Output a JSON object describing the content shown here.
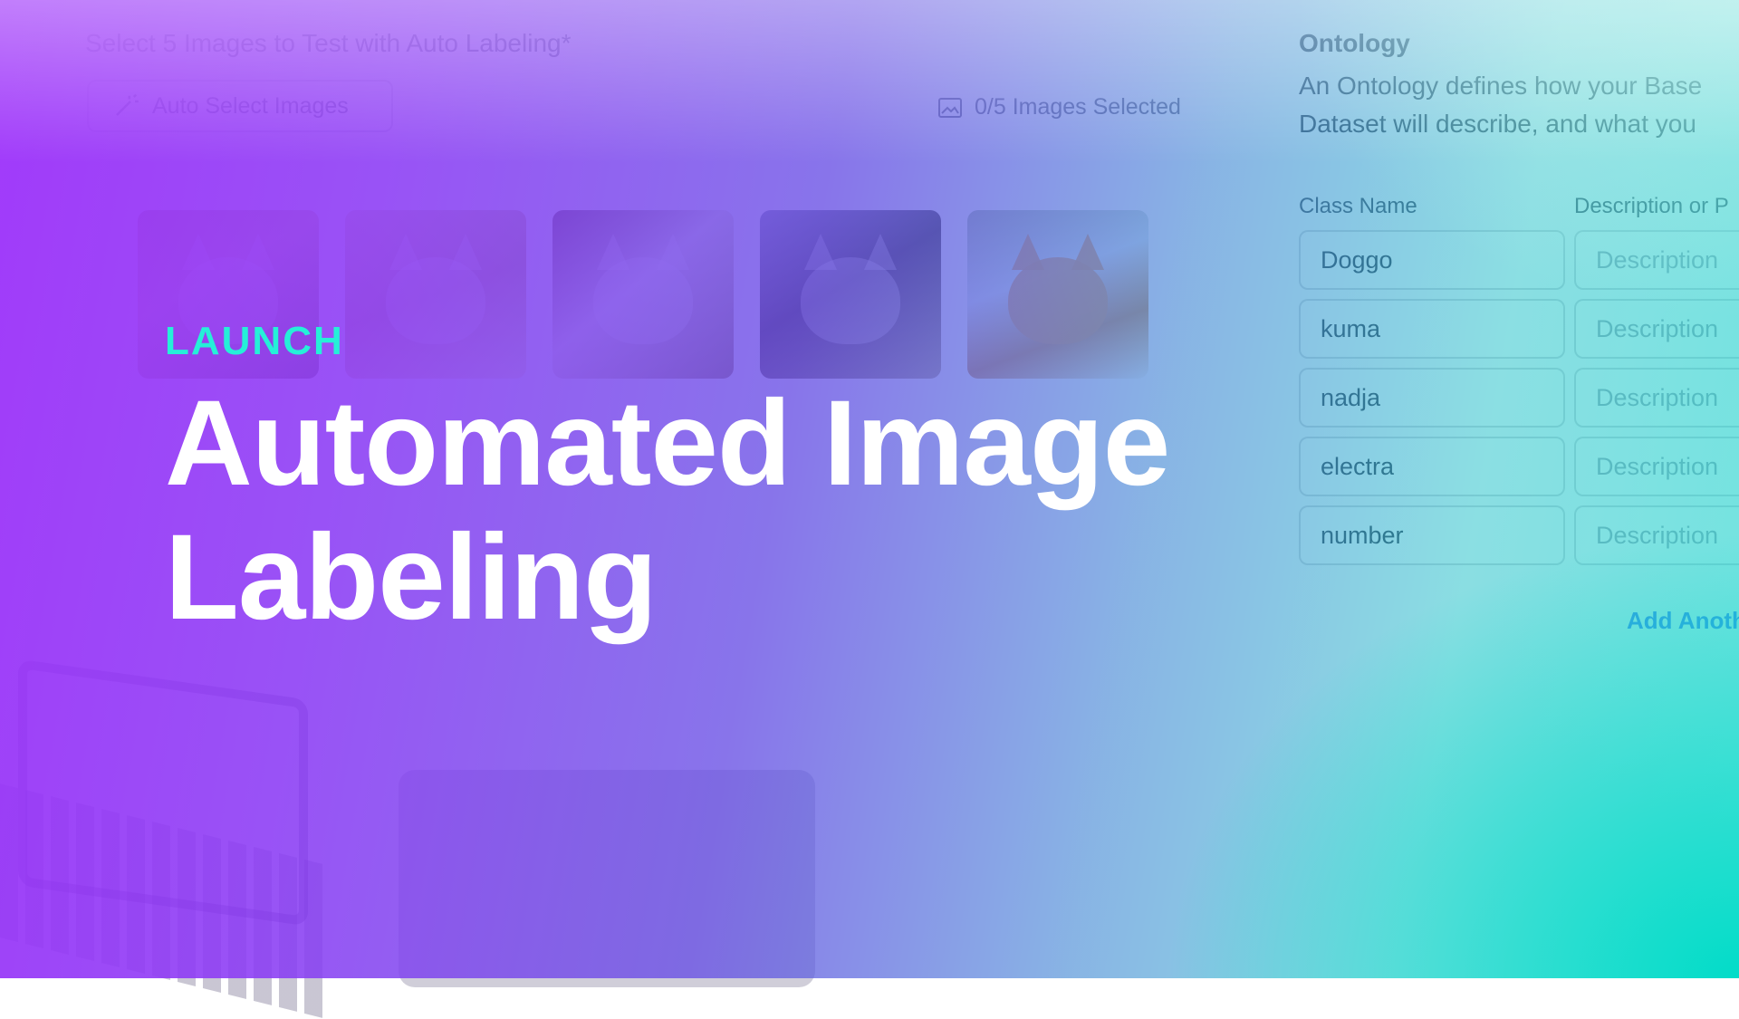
{
  "left_panel": {
    "title": "Select 5 Images to Test with Auto Labeling*",
    "auto_select_label": "Auto Select Images",
    "images_selected": "0/5 Images Selected",
    "thumbnails": [
      "dog-photo-1",
      "dog-photo-2",
      "dog-photo-3",
      "dog-photo-4",
      "dog-photo-5"
    ]
  },
  "ontology": {
    "title": "Ontology",
    "description_line1": "An Ontology defines how your Base",
    "description_line2": "Dataset will describe, and what you",
    "class_name_header": "Class Name",
    "description_header": "Description or P",
    "classes": [
      "Doggo",
      "kuma",
      "nadja",
      "electra",
      "number"
    ],
    "description_placeholder": "Description",
    "add_another": "Add Anoth"
  },
  "hero": {
    "eyebrow": "LAUNCH",
    "title_line1": "Automated Image",
    "title_line2": "Labeling"
  },
  "colors": {
    "purple": "#9e32fa",
    "teal": "#00dcc8",
    "eyebrow": "#25f0d8",
    "white": "#ffffff"
  }
}
